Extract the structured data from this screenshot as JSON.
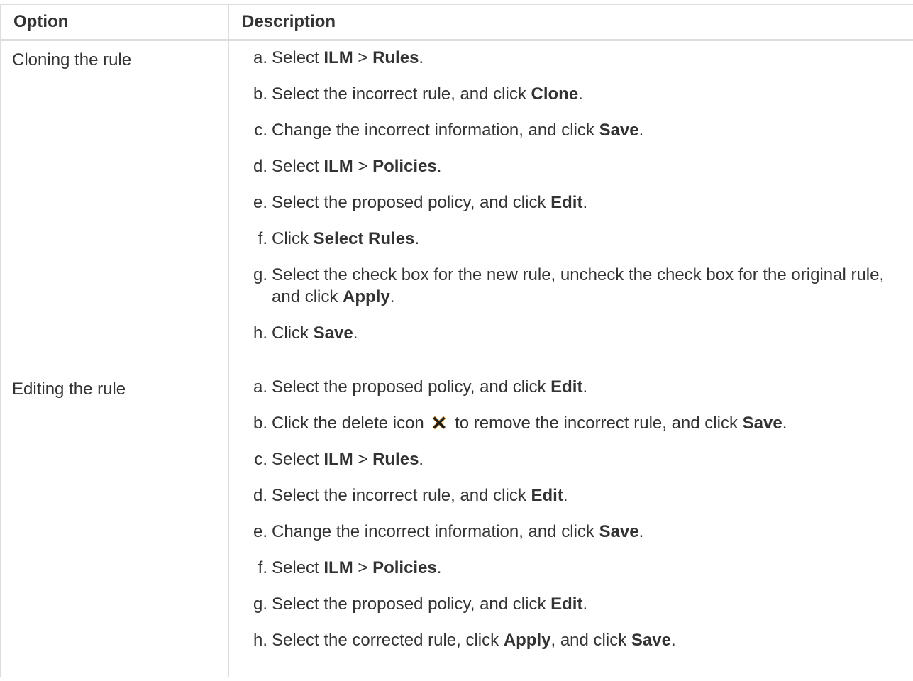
{
  "table": {
    "headers": [
      "Option",
      "Description"
    ],
    "rows": [
      {
        "option": "Cloning the rule",
        "steps": [
          {
            "marker": "a.",
            "parts": [
              {
                "t": "Select "
              },
              {
                "b": "ILM"
              },
              {
                "t": " > "
              },
              {
                "b": "Rules"
              },
              {
                "t": "."
              }
            ]
          },
          {
            "marker": "b.",
            "parts": [
              {
                "t": "Select the incorrect rule, and click "
              },
              {
                "b": "Clone"
              },
              {
                "t": "."
              }
            ]
          },
          {
            "marker": "c.",
            "parts": [
              {
                "t": "Change the incorrect information, and click "
              },
              {
                "b": "Save"
              },
              {
                "t": "."
              }
            ]
          },
          {
            "marker": "d.",
            "parts": [
              {
                "t": "Select "
              },
              {
                "b": "ILM"
              },
              {
                "t": " > "
              },
              {
                "b": "Policies"
              },
              {
                "t": "."
              }
            ]
          },
          {
            "marker": "e.",
            "parts": [
              {
                "t": "Select the proposed policy, and click "
              },
              {
                "b": "Edit"
              },
              {
                "t": "."
              }
            ]
          },
          {
            "marker": "f.",
            "parts": [
              {
                "t": "Click "
              },
              {
                "b": "Select Rules"
              },
              {
                "t": "."
              }
            ]
          },
          {
            "marker": "g.",
            "parts": [
              {
                "t": "Select the check box for the new rule, uncheck the check box for the original rule, and click "
              },
              {
                "b": "Apply"
              },
              {
                "t": "."
              }
            ]
          },
          {
            "marker": "h.",
            "parts": [
              {
                "t": "Click "
              },
              {
                "b": "Save"
              },
              {
                "t": "."
              }
            ]
          }
        ]
      },
      {
        "option": "Editing the rule",
        "steps": [
          {
            "marker": "a.",
            "parts": [
              {
                "t": "Select the proposed policy, and click "
              },
              {
                "b": "Edit"
              },
              {
                "t": "."
              }
            ]
          },
          {
            "marker": "b.",
            "parts": [
              {
                "t": "Click the delete icon "
              },
              {
                "icon": "delete-x-icon"
              },
              {
                "t": " to remove the incorrect rule, and click "
              },
              {
                "b": "Save"
              },
              {
                "t": "."
              }
            ]
          },
          {
            "marker": "c.",
            "parts": [
              {
                "t": "Select "
              },
              {
                "b": "ILM"
              },
              {
                "t": " > "
              },
              {
                "b": "Rules"
              },
              {
                "t": "."
              }
            ]
          },
          {
            "marker": "d.",
            "parts": [
              {
                "t": "Select the incorrect rule, and click "
              },
              {
                "b": "Edit"
              },
              {
                "t": "."
              }
            ]
          },
          {
            "marker": "e.",
            "parts": [
              {
                "t": "Change the incorrect information, and click "
              },
              {
                "b": "Save"
              },
              {
                "t": "."
              }
            ]
          },
          {
            "marker": "f.",
            "parts": [
              {
                "t": "Select "
              },
              {
                "b": "ILM"
              },
              {
                "t": " > "
              },
              {
                "b": "Policies"
              },
              {
                "t": "."
              }
            ]
          },
          {
            "marker": "g.",
            "parts": [
              {
                "t": "Select the proposed policy, and click "
              },
              {
                "b": "Edit"
              },
              {
                "t": "."
              }
            ]
          },
          {
            "marker": "h.",
            "parts": [
              {
                "t": "Select the corrected rule, click "
              },
              {
                "b": "Apply"
              },
              {
                "t": ", and click "
              },
              {
                "b": "Save"
              },
              {
                "t": "."
              }
            ]
          }
        ]
      }
    ]
  },
  "colors": {
    "text": "#333333",
    "border": "#dddddd",
    "background": "#ffffff"
  }
}
